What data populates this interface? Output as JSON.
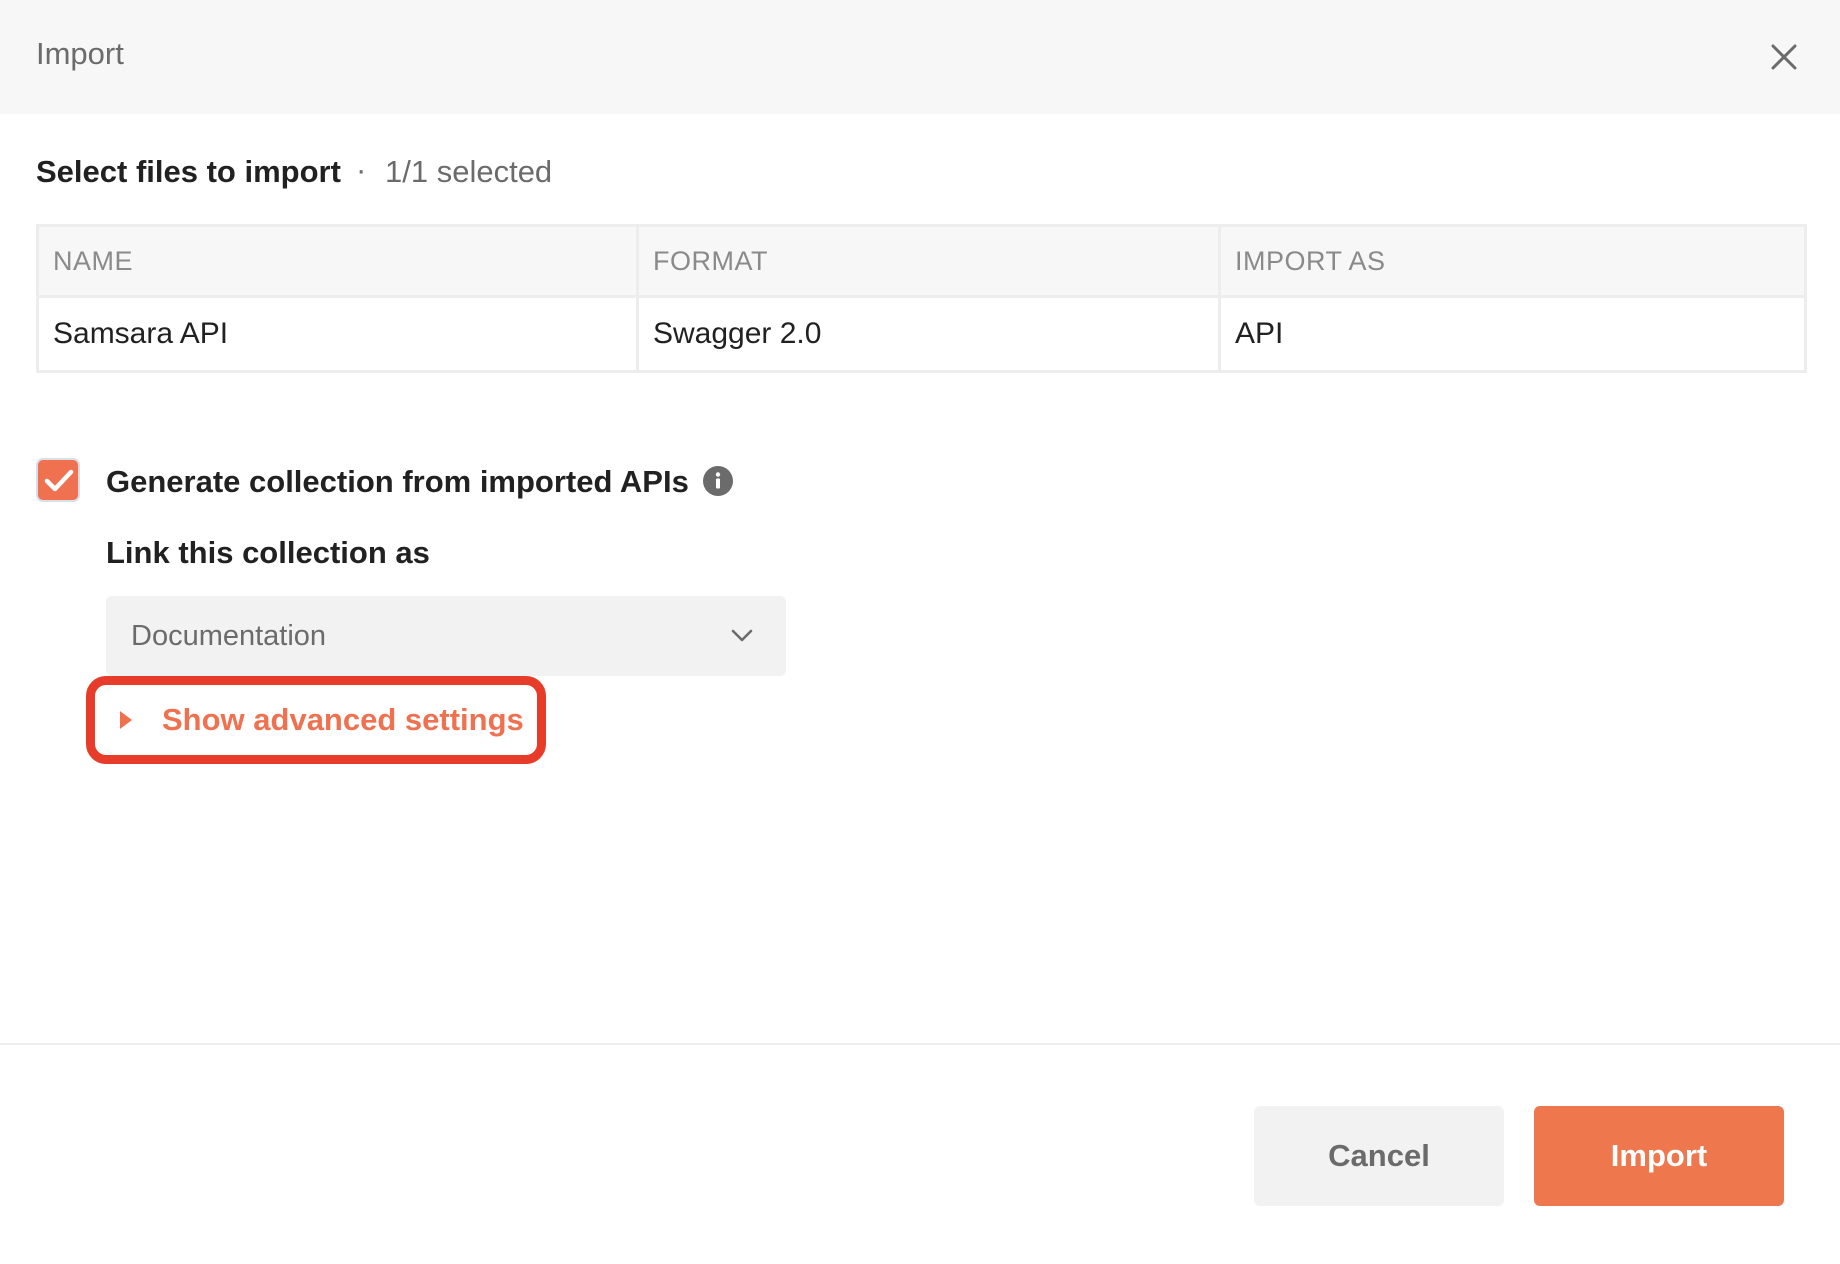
{
  "dialog": {
    "title": "Import",
    "close_icon": "close-icon"
  },
  "files_section": {
    "title": "Select files to import",
    "separator": "·",
    "selected_count": "1/1 selected"
  },
  "table": {
    "columns": [
      "NAME",
      "FORMAT",
      "IMPORT AS"
    ],
    "rows": [
      [
        "Samsara API",
        "Swagger 2.0",
        "API"
      ]
    ]
  },
  "generate_collection": {
    "checked": true,
    "label": "Generate collection from imported APIs",
    "info_icon": "info-icon"
  },
  "link_collection": {
    "label": "Link this collection as",
    "selected": "Documentation",
    "chevron_icon": "chevron-down-icon"
  },
  "advanced": {
    "label": "Show advanced settings",
    "arrow_icon": "caret-right-icon"
  },
  "footer": {
    "cancel_label": "Cancel",
    "import_label": "Import"
  },
  "colors": {
    "accent": "#EF774D",
    "highlight": "#E83C2A",
    "header_bg": "#F7F7F7"
  }
}
